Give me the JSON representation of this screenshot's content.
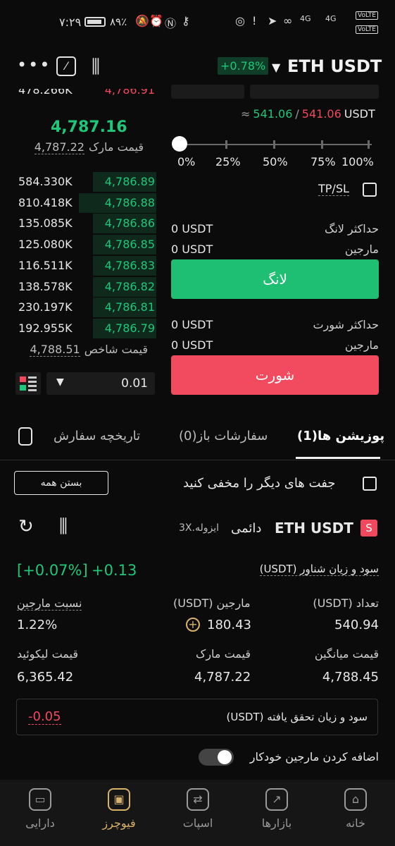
{
  "status_bar": {
    "time": "۷:۲۹",
    "battery": "۸۹٪",
    "volte1": "VoLTE",
    "volte2": "VoLTE",
    "net1": "4G",
    "net2": "4G"
  },
  "header": {
    "change": "+0.78%",
    "pair": "ETH USDT",
    "menu_icon": "more-dots-icon",
    "calc_icon": "calculator-icon",
    "chart_icon": "candles-icon"
  },
  "order_book": {
    "top_cut_qty": "478.266K",
    "top_cut_price": "4,786.91",
    "last_price": "4,787.16",
    "mark_label": "قیمت مارک",
    "mark_value": "4,787.22",
    "bids": [
      {
        "qty": "584.330K",
        "price": "4,786.89",
        "depth": 0.45
      },
      {
        "qty": "810.418K",
        "price": "4,786.88",
        "depth": 0.55
      },
      {
        "qty": "135.085K",
        "price": "4,786.86",
        "depth": 0.45
      },
      {
        "qty": "125.080K",
        "price": "4,786.85",
        "depth": 0.45
      },
      {
        "qty": "116.511K",
        "price": "4,786.83",
        "depth": 0.45
      },
      {
        "qty": "138.578K",
        "price": "4,786.82",
        "depth": 0.45
      },
      {
        "qty": "230.197K",
        "price": "4,786.81",
        "depth": 0.45
      },
      {
        "qty": "192.955K",
        "price": "4,786.79",
        "depth": 0.45
      }
    ],
    "index_label": "قیمت شاخص",
    "index_value": "4,788.51",
    "precision": "0.01"
  },
  "order_form": {
    "approx": "≈",
    "buy_cost": "541.06",
    "sep": "/",
    "sell_cost": "541.06",
    "unit": "USDT",
    "percents": [
      "0%",
      "25%",
      "50%",
      "75%",
      "100%"
    ],
    "slider_value": 0,
    "tpsl": "TP/SL",
    "max_long_label": "حداکثر لانگ",
    "max_long_value": "0 USDT",
    "margin_label": "مارجین",
    "margin_long_value": "0 USDT",
    "long_button": "لانگ",
    "max_short_label": "حداکثر شورت",
    "max_short_value": "0 USDT",
    "margin_short_value": "0 USDT",
    "short_button": "شورت"
  },
  "tabs": {
    "positions": "پوزیشن ها(1)",
    "open_orders": "سفارشات باز(0)",
    "history": "تاریخچه سفارش"
  },
  "positions": {
    "hide_others": "جفت های دیگر را مخفی کنید",
    "close_all": "بستن همه",
    "badge": "S",
    "symbol": "ETH USDT",
    "perpetual": "دائمی",
    "mode": "ایزوله.3X",
    "unrealized_label": "سود و زیان شناور (USDT)",
    "unrealized_value": "+0.13",
    "unrealized_pct": "[+0.07%]",
    "qty_label": "تعداد (USDT)",
    "qty_value": "540.94",
    "margin_label": "مارجین (USDT)",
    "margin_value": "180.43",
    "margin_ratio_label": "نسبت مارجین",
    "margin_ratio_value": "1.22%",
    "avg_price_label": "قیمت میانگین",
    "avg_price_value": "4,788.45",
    "mark_price_label": "قیمت مارک",
    "mark_price_value": "4,787.22",
    "liq_price_label": "قیمت لیکوئید",
    "liq_price_value": "6,365.42",
    "realized_label": "سود و زیان تحقق یافته (USDT)",
    "realized_value": "-0.05",
    "auto_margin_label": "اضافه کردن مارجین خودکار"
  },
  "nav": {
    "home": "خانه",
    "markets": "بازارها",
    "spot": "اسپات",
    "futures": "فیوچرز",
    "assets": "دارایی"
  }
}
